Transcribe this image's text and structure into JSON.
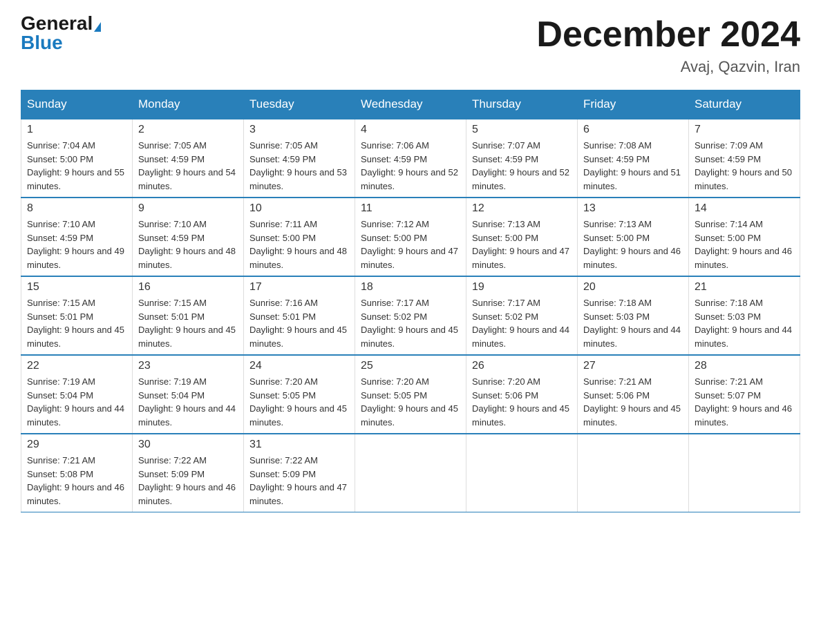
{
  "header": {
    "logo_general": "General",
    "logo_blue": "Blue",
    "month_title": "December 2024",
    "location": "Avaj, Qazvin, Iran"
  },
  "days_of_week": [
    "Sunday",
    "Monday",
    "Tuesday",
    "Wednesday",
    "Thursday",
    "Friday",
    "Saturday"
  ],
  "weeks": [
    [
      {
        "day": "1",
        "sunrise": "7:04 AM",
        "sunset": "5:00 PM",
        "daylight": "9 hours and 55 minutes."
      },
      {
        "day": "2",
        "sunrise": "7:05 AM",
        "sunset": "4:59 PM",
        "daylight": "9 hours and 54 minutes."
      },
      {
        "day": "3",
        "sunrise": "7:05 AM",
        "sunset": "4:59 PM",
        "daylight": "9 hours and 53 minutes."
      },
      {
        "day": "4",
        "sunrise": "7:06 AM",
        "sunset": "4:59 PM",
        "daylight": "9 hours and 52 minutes."
      },
      {
        "day": "5",
        "sunrise": "7:07 AM",
        "sunset": "4:59 PM",
        "daylight": "9 hours and 52 minutes."
      },
      {
        "day": "6",
        "sunrise": "7:08 AM",
        "sunset": "4:59 PM",
        "daylight": "9 hours and 51 minutes."
      },
      {
        "day": "7",
        "sunrise": "7:09 AM",
        "sunset": "4:59 PM",
        "daylight": "9 hours and 50 minutes."
      }
    ],
    [
      {
        "day": "8",
        "sunrise": "7:10 AM",
        "sunset": "4:59 PM",
        "daylight": "9 hours and 49 minutes."
      },
      {
        "day": "9",
        "sunrise": "7:10 AM",
        "sunset": "4:59 PM",
        "daylight": "9 hours and 48 minutes."
      },
      {
        "day": "10",
        "sunrise": "7:11 AM",
        "sunset": "5:00 PM",
        "daylight": "9 hours and 48 minutes."
      },
      {
        "day": "11",
        "sunrise": "7:12 AM",
        "sunset": "5:00 PM",
        "daylight": "9 hours and 47 minutes."
      },
      {
        "day": "12",
        "sunrise": "7:13 AM",
        "sunset": "5:00 PM",
        "daylight": "9 hours and 47 minutes."
      },
      {
        "day": "13",
        "sunrise": "7:13 AM",
        "sunset": "5:00 PM",
        "daylight": "9 hours and 46 minutes."
      },
      {
        "day": "14",
        "sunrise": "7:14 AM",
        "sunset": "5:00 PM",
        "daylight": "9 hours and 46 minutes."
      }
    ],
    [
      {
        "day": "15",
        "sunrise": "7:15 AM",
        "sunset": "5:01 PM",
        "daylight": "9 hours and 45 minutes."
      },
      {
        "day": "16",
        "sunrise": "7:15 AM",
        "sunset": "5:01 PM",
        "daylight": "9 hours and 45 minutes."
      },
      {
        "day": "17",
        "sunrise": "7:16 AM",
        "sunset": "5:01 PM",
        "daylight": "9 hours and 45 minutes."
      },
      {
        "day": "18",
        "sunrise": "7:17 AM",
        "sunset": "5:02 PM",
        "daylight": "9 hours and 45 minutes."
      },
      {
        "day": "19",
        "sunrise": "7:17 AM",
        "sunset": "5:02 PM",
        "daylight": "9 hours and 44 minutes."
      },
      {
        "day": "20",
        "sunrise": "7:18 AM",
        "sunset": "5:03 PM",
        "daylight": "9 hours and 44 minutes."
      },
      {
        "day": "21",
        "sunrise": "7:18 AM",
        "sunset": "5:03 PM",
        "daylight": "9 hours and 44 minutes."
      }
    ],
    [
      {
        "day": "22",
        "sunrise": "7:19 AM",
        "sunset": "5:04 PM",
        "daylight": "9 hours and 44 minutes."
      },
      {
        "day": "23",
        "sunrise": "7:19 AM",
        "sunset": "5:04 PM",
        "daylight": "9 hours and 44 minutes."
      },
      {
        "day": "24",
        "sunrise": "7:20 AM",
        "sunset": "5:05 PM",
        "daylight": "9 hours and 45 minutes."
      },
      {
        "day": "25",
        "sunrise": "7:20 AM",
        "sunset": "5:05 PM",
        "daylight": "9 hours and 45 minutes."
      },
      {
        "day": "26",
        "sunrise": "7:20 AM",
        "sunset": "5:06 PM",
        "daylight": "9 hours and 45 minutes."
      },
      {
        "day": "27",
        "sunrise": "7:21 AM",
        "sunset": "5:06 PM",
        "daylight": "9 hours and 45 minutes."
      },
      {
        "day": "28",
        "sunrise": "7:21 AM",
        "sunset": "5:07 PM",
        "daylight": "9 hours and 46 minutes."
      }
    ],
    [
      {
        "day": "29",
        "sunrise": "7:21 AM",
        "sunset": "5:08 PM",
        "daylight": "9 hours and 46 minutes."
      },
      {
        "day": "30",
        "sunrise": "7:22 AM",
        "sunset": "5:09 PM",
        "daylight": "9 hours and 46 minutes."
      },
      {
        "day": "31",
        "sunrise": "7:22 AM",
        "sunset": "5:09 PM",
        "daylight": "9 hours and 47 minutes."
      },
      null,
      null,
      null,
      null
    ]
  ],
  "labels": {
    "sunrise": "Sunrise:",
    "sunset": "Sunset:",
    "daylight": "Daylight:"
  }
}
